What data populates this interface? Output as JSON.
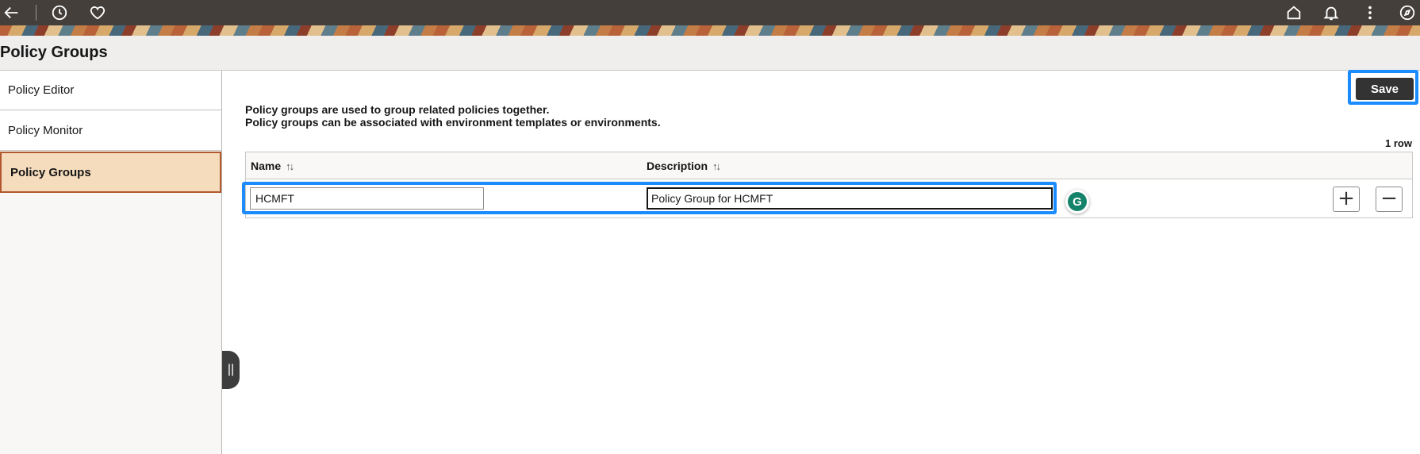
{
  "topbar": {
    "icons": {
      "back": "back-arrow-icon",
      "recent": "clock-icon",
      "favorites": "heart-icon",
      "home": "home-icon",
      "notifications": "bell-icon",
      "actions": "more-vertical-icon",
      "navigator": "compass-icon"
    }
  },
  "page": {
    "title": "Policy Groups"
  },
  "sidebar": {
    "items": [
      {
        "label": "Policy Editor"
      },
      {
        "label": "Policy Monitor"
      },
      {
        "label": "Policy Groups",
        "active": true
      }
    ],
    "collapse_glyph": "||"
  },
  "toolbar": {
    "save_label": "Save"
  },
  "intro": {
    "line1": "Policy groups are used to group related policies together.",
    "line2": "Policy groups can be associated with environment templates or environments."
  },
  "grid": {
    "row_count": "1 row",
    "columns": [
      {
        "label": "Name"
      },
      {
        "label": "Description"
      }
    ],
    "sort_glyph": "↑↓",
    "rows": [
      {
        "name": "HCMFT",
        "description": "Policy Group for HCMFT"
      }
    ],
    "add_row": "+",
    "delete_row": "−"
  },
  "grammarly": {
    "glyph": "G"
  },
  "colors": {
    "highlight": "#1a8cff",
    "topbar": "#443f3b",
    "active_nav": "#f5dcbd",
    "active_nav_border": "#b2572e",
    "save_button": "#333333"
  }
}
